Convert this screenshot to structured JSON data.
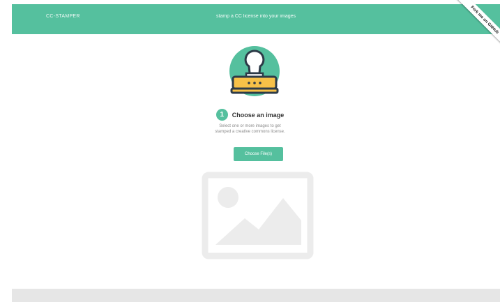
{
  "header": {
    "brand": "CC-STAMPER",
    "tagline": "stamp a CC license into your images",
    "ribbon": "Fork me on GitHub"
  },
  "step": {
    "number": "1",
    "title": "Choose an image",
    "description_line1": "Select one or more images to get",
    "description_line2": "stamped a creative commons license."
  },
  "upload": {
    "button_label": "Choose File(s)"
  },
  "colors": {
    "accent": "#55c09e",
    "stamp_yellow": "#f7c148",
    "outline": "#2d3b48",
    "placeholder_gray": "#ececec",
    "footer_gray": "#e6e6e6"
  },
  "icons": {
    "hero": "rubber-stamp-icon",
    "placeholder": "image-placeholder-icon"
  }
}
